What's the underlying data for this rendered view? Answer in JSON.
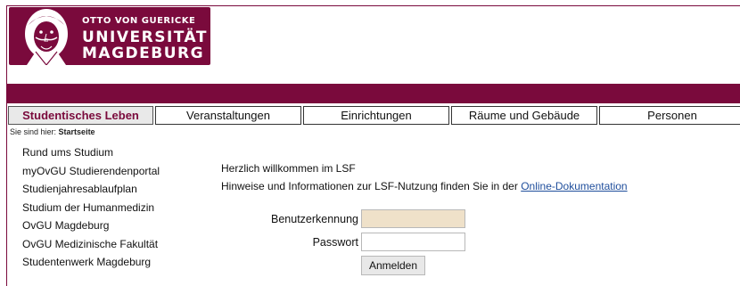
{
  "logo": {
    "line_top": "OTTO VON GUERICKE",
    "line_1": "UNIVERSITÄT",
    "line_2": "MAGDEBURG"
  },
  "colors": {
    "brand": "#7a0a3c",
    "username_bg": "#efe1c9",
    "link": "#1f4e9c"
  },
  "nav": {
    "tabs": [
      {
        "label": "Studentisches Leben",
        "active": true
      },
      {
        "label": "Veranstaltungen"
      },
      {
        "label": "Einrichtungen"
      },
      {
        "label": "Räume und Gebäude"
      },
      {
        "label": "Personen"
      }
    ]
  },
  "breadcrumb": {
    "prefix": "Sie sind hier:",
    "current": "Startseite"
  },
  "sidebar": {
    "items": [
      "Rund ums Studium",
      "myOvGU Studierendenportal",
      "Studienjahresablaufplan",
      "Studium der Humanmedizin",
      "OvGU Magdeburg",
      "OvGU Medizinische Fakultät",
      "Studentenwerk Magdeburg"
    ]
  },
  "main": {
    "welcome": "Herzlich willkommen im LSF",
    "hint_text": "Hinweise und Informationen zur LSF-Nutzung finden Sie in der",
    "hint_link": "Online-Dokumentation"
  },
  "login": {
    "username_label": "Benutzerkennung",
    "username_value": "",
    "password_label": "Passwort",
    "password_value": "",
    "submit_label": "Anmelden"
  }
}
